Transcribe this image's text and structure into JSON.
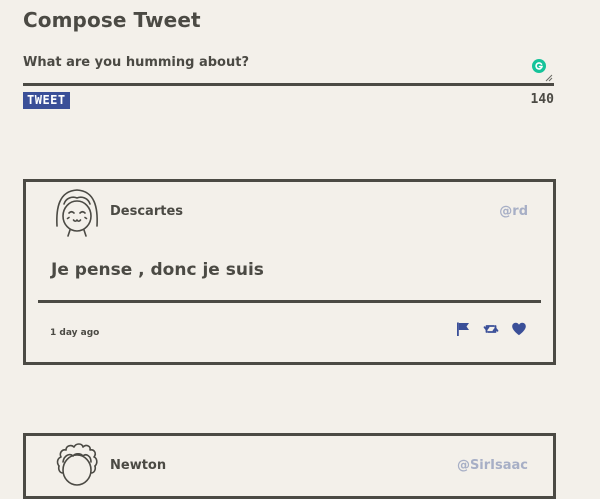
{
  "compose": {
    "title": "Compose Tweet",
    "placeholder": "What are you humming about?",
    "button_label": "TWEET",
    "counter": "140"
  },
  "colors": {
    "background": "#f3f0ea",
    "text": "#4b4a44",
    "accent": "#3a4f98",
    "handle": "#a7afc6",
    "grammarly": "#15c39a"
  },
  "tweets": [
    {
      "name": "Descartes",
      "handle": "@rd",
      "text": "Je pense , donc je suis",
      "time": "1 day ago",
      "avatar_icon": "girl-avatar-icon",
      "actions": [
        "flag-icon",
        "retweet-icon",
        "heart-icon"
      ]
    },
    {
      "name": "Newton",
      "handle": "@SirIsaac",
      "avatar_icon": "curly-hair-avatar-icon"
    }
  ]
}
